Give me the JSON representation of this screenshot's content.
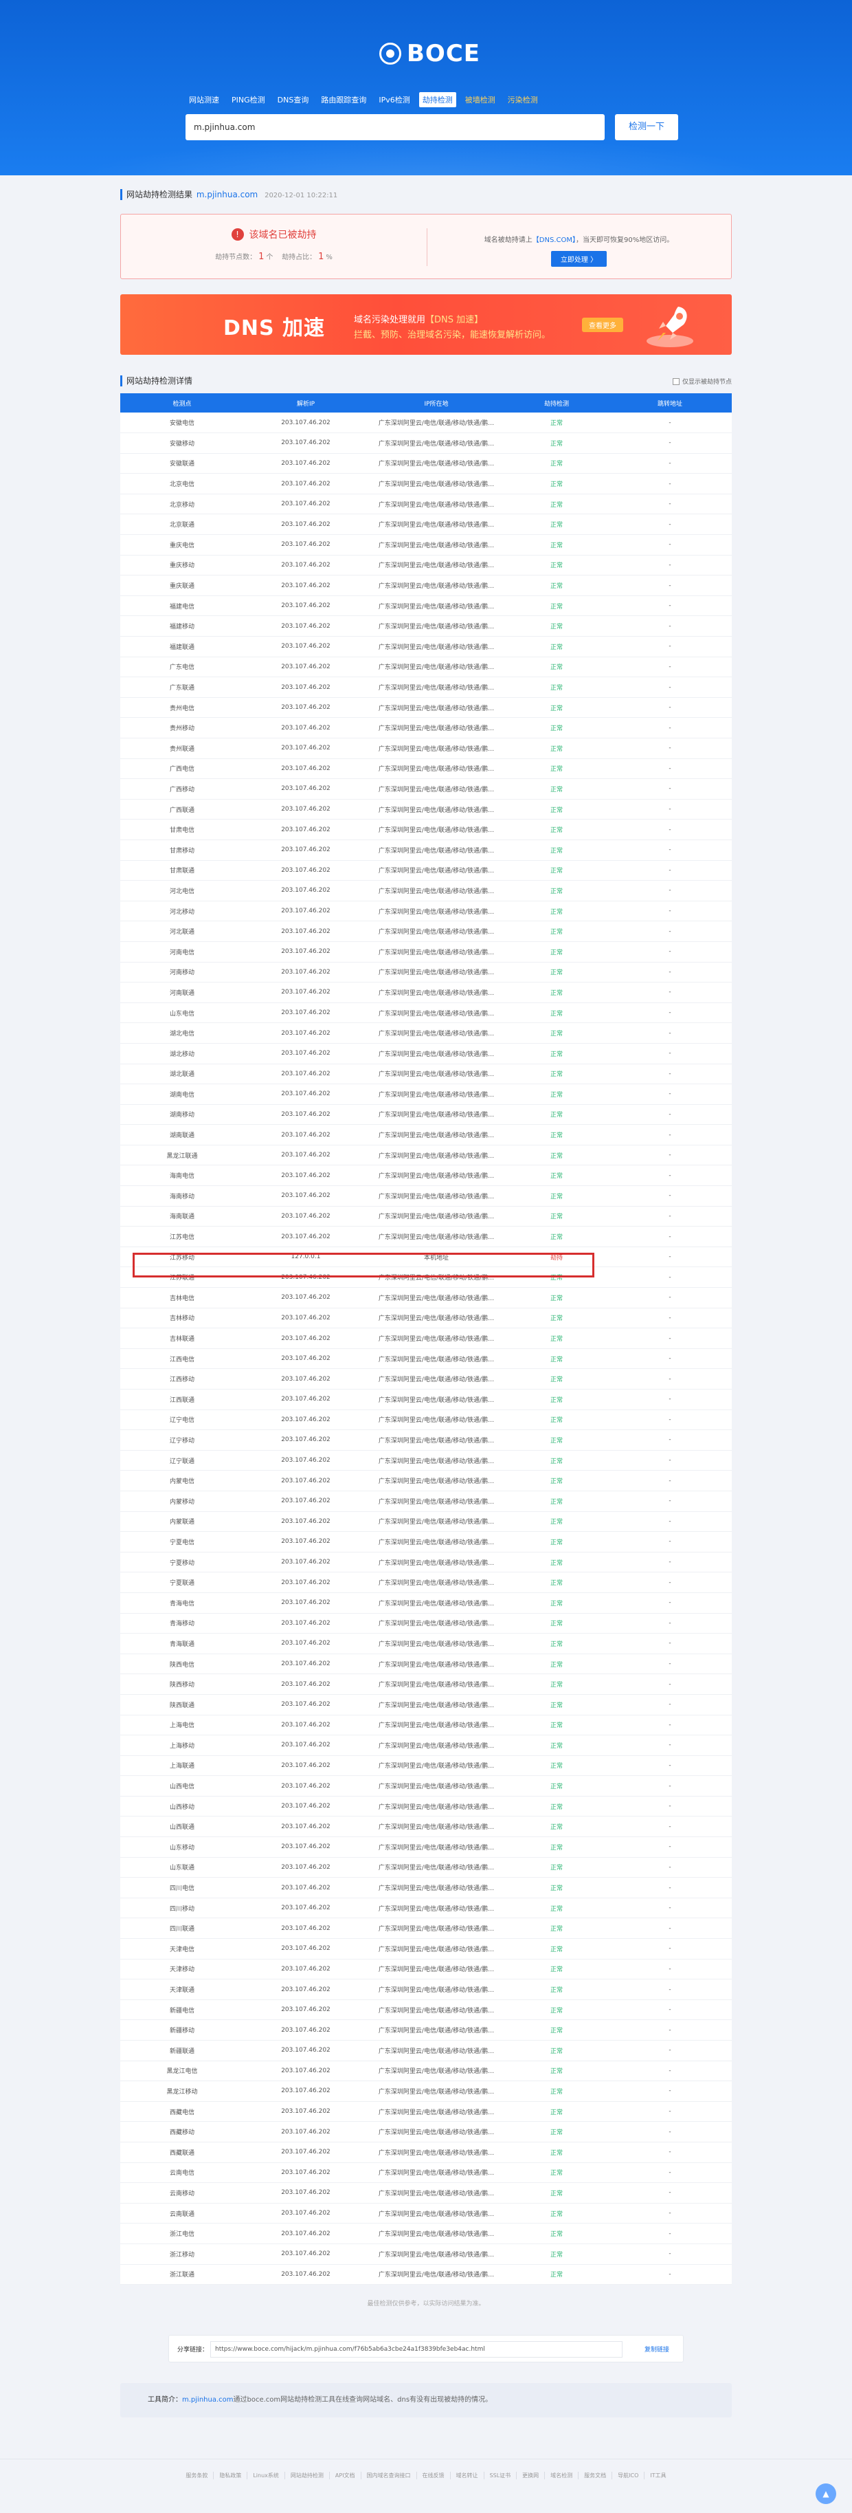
{
  "brand": {
    "logo_text": "BOCE",
    "primary": "#1a73e8",
    "danger": "#e0413d",
    "ok": "#2bb673"
  },
  "nav": [
    {
      "label": "网站测速",
      "style": "normal"
    },
    {
      "label": "PING检测",
      "style": "normal"
    },
    {
      "label": "DNS查询",
      "style": "normal"
    },
    {
      "label": "路由跟踪查询",
      "style": "normal"
    },
    {
      "label": "IPv6检测",
      "style": "normal"
    },
    {
      "label": "劫持检测",
      "style": "active"
    },
    {
      "label": "被墙检测",
      "style": "yellow"
    },
    {
      "label": "污染检测",
      "style": "yellow"
    }
  ],
  "search": {
    "value": "m.pjinhua.com",
    "button": "检测一下"
  },
  "result": {
    "title": "网站劫持检测结果",
    "domain": "m.pjinhua.com",
    "time": "2020-12-01 10:22:11"
  },
  "summary": {
    "warn_icon": "exclamation-icon",
    "warn": "该域名已被劫持",
    "nodes_label": "劫持节点数：",
    "nodes_value": "1",
    "nodes_unit": "个",
    "rate_label": "劫持占比：",
    "rate_value": "1",
    "rate_unit": "%",
    "right_a": "域名被劫持请上",
    "right_link": "【DNS.COM】",
    "right_b": "，当天即可恢复90%地区访问。",
    "button": "立即处理 〉"
  },
  "banner": {
    "big": "DNS 加速",
    "line1_a": "域名污染处理就用",
    "line1_b": "【DNS 加速】",
    "line2": "拦截、预防、治理域名污染，能速恢复解析访问。",
    "button": "查看更多",
    "icon": "rocket-icon"
  },
  "detail": {
    "title": "网站劫持检测详情",
    "checkbox": "仅显示被劫持节点"
  },
  "columns": [
    "检测点",
    "解析IP",
    "IP所在地",
    "劫持检测",
    "跳转地址"
  ],
  "rows": [
    [
      "安徽电信",
      "203.107.46.202",
      "广东深圳阿里云/电信/联通/移动/铁通/鹏…",
      "正常",
      "-"
    ],
    [
      "安徽移动",
      "203.107.46.202",
      "广东深圳阿里云/电信/联通/移动/铁通/鹏…",
      "正常",
      "-"
    ],
    [
      "安徽联通",
      "203.107.46.202",
      "广东深圳阿里云/电信/联通/移动/铁通/鹏…",
      "正常",
      "-"
    ],
    [
      "北京电信",
      "203.107.46.202",
      "广东深圳阿里云/电信/联通/移动/铁通/鹏…",
      "正常",
      "-"
    ],
    [
      "北京移动",
      "203.107.46.202",
      "广东深圳阿里云/电信/联通/移动/铁通/鹏…",
      "正常",
      "-"
    ],
    [
      "北京联通",
      "203.107.46.202",
      "广东深圳阿里云/电信/联通/移动/铁通/鹏…",
      "正常",
      "-"
    ],
    [
      "重庆电信",
      "203.107.46.202",
      "广东深圳阿里云/电信/联通/移动/铁通/鹏…",
      "正常",
      "-"
    ],
    [
      "重庆移动",
      "203.107.46.202",
      "广东深圳阿里云/电信/联通/移动/铁通/鹏…",
      "正常",
      "-"
    ],
    [
      "重庆联通",
      "203.107.46.202",
      "广东深圳阿里云/电信/联通/移动/铁通/鹏…",
      "正常",
      "-"
    ],
    [
      "福建电信",
      "203.107.46.202",
      "广东深圳阿里云/电信/联通/移动/铁通/鹏…",
      "正常",
      "-"
    ],
    [
      "福建移动",
      "203.107.46.202",
      "广东深圳阿里云/电信/联通/移动/铁通/鹏…",
      "正常",
      "-"
    ],
    [
      "福建联通",
      "203.107.46.202",
      "广东深圳阿里云/电信/联通/移动/铁通/鹏…",
      "正常",
      "-"
    ],
    [
      "广东电信",
      "203.107.46.202",
      "广东深圳阿里云/电信/联通/移动/铁通/鹏…",
      "正常",
      "-"
    ],
    [
      "广东联通",
      "203.107.46.202",
      "广东深圳阿里云/电信/联通/移动/铁通/鹏…",
      "正常",
      "-"
    ],
    [
      "贵州电信",
      "203.107.46.202",
      "广东深圳阿里云/电信/联通/移动/铁通/鹏…",
      "正常",
      "-"
    ],
    [
      "贵州移动",
      "203.107.46.202",
      "广东深圳阿里云/电信/联通/移动/铁通/鹏…",
      "正常",
      "-"
    ],
    [
      "贵州联通",
      "203.107.46.202",
      "广东深圳阿里云/电信/联通/移动/铁通/鹏…",
      "正常",
      "-"
    ],
    [
      "广西电信",
      "203.107.46.202",
      "广东深圳阿里云/电信/联通/移动/铁通/鹏…",
      "正常",
      "-"
    ],
    [
      "广西移动",
      "203.107.46.202",
      "广东深圳阿里云/电信/联通/移动/铁通/鹏…",
      "正常",
      "-"
    ],
    [
      "广西联通",
      "203.107.46.202",
      "广东深圳阿里云/电信/联通/移动/铁通/鹏…",
      "正常",
      "-"
    ],
    [
      "甘肃电信",
      "203.107.46.202",
      "广东深圳阿里云/电信/联通/移动/铁通/鹏…",
      "正常",
      "-"
    ],
    [
      "甘肃移动",
      "203.107.46.202",
      "广东深圳阿里云/电信/联通/移动/铁通/鹏…",
      "正常",
      "-"
    ],
    [
      "甘肃联通",
      "203.107.46.202",
      "广东深圳阿里云/电信/联通/移动/铁通/鹏…",
      "正常",
      "-"
    ],
    [
      "河北电信",
      "203.107.46.202",
      "广东深圳阿里云/电信/联通/移动/铁通/鹏…",
      "正常",
      "-"
    ],
    [
      "河北移动",
      "203.107.46.202",
      "广东深圳阿里云/电信/联通/移动/铁通/鹏…",
      "正常",
      "-"
    ],
    [
      "河北联通",
      "203.107.46.202",
      "广东深圳阿里云/电信/联通/移动/铁通/鹏…",
      "正常",
      "-"
    ],
    [
      "河南电信",
      "203.107.46.202",
      "广东深圳阿里云/电信/联通/移动/铁通/鹏…",
      "正常",
      "-"
    ],
    [
      "河南移动",
      "203.107.46.202",
      "广东深圳阿里云/电信/联通/移动/铁通/鹏…",
      "正常",
      "-"
    ],
    [
      "河南联通",
      "203.107.46.202",
      "广东深圳阿里云/电信/联通/移动/铁通/鹏…",
      "正常",
      "-"
    ],
    [
      "山东电信",
      "203.107.46.202",
      "广东深圳阿里云/电信/联通/移动/铁通/鹏…",
      "正常",
      "-"
    ],
    [
      "湖北电信",
      "203.107.46.202",
      "广东深圳阿里云/电信/联通/移动/铁通/鹏…",
      "正常",
      "-"
    ],
    [
      "湖北移动",
      "203.107.46.202",
      "广东深圳阿里云/电信/联通/移动/铁通/鹏…",
      "正常",
      "-"
    ],
    [
      "湖北联通",
      "203.107.46.202",
      "广东深圳阿里云/电信/联通/移动/铁通/鹏…",
      "正常",
      "-"
    ],
    [
      "湖南电信",
      "203.107.46.202",
      "广东深圳阿里云/电信/联通/移动/铁通/鹏…",
      "正常",
      "-"
    ],
    [
      "湖南移动",
      "203.107.46.202",
      "广东深圳阿里云/电信/联通/移动/铁通/鹏…",
      "正常",
      "-"
    ],
    [
      "湖南联通",
      "203.107.46.202",
      "广东深圳阿里云/电信/联通/移动/铁通/鹏…",
      "正常",
      "-"
    ],
    [
      "黑龙江联通",
      "203.107.46.202",
      "广东深圳阿里云/电信/联通/移动/铁通/鹏…",
      "正常",
      "-"
    ],
    [
      "海南电信",
      "203.107.46.202",
      "广东深圳阿里云/电信/联通/移动/铁通/鹏…",
      "正常",
      "-"
    ],
    [
      "海南移动",
      "203.107.46.202",
      "广东深圳阿里云/电信/联通/移动/铁通/鹏…",
      "正常",
      "-"
    ],
    [
      "海南联通",
      "203.107.46.202",
      "广东深圳阿里云/电信/联通/移动/铁通/鹏…",
      "正常",
      "-"
    ],
    [
      "江苏电信",
      "203.107.46.202",
      "广东深圳阿里云/电信/联通/移动/铁通/鹏…",
      "正常",
      "-"
    ],
    [
      "江苏移动",
      "127.0.0.1",
      "本机地址",
      "劫持",
      "-"
    ],
    [
      "江苏联通",
      "203.107.46.202",
      "广东深圳阿里云/电信/联通/移动/铁通/鹏…",
      "正常",
      "-"
    ],
    [
      "吉林电信",
      "203.107.46.202",
      "广东深圳阿里云/电信/联通/移动/铁通/鹏…",
      "正常",
      "-"
    ],
    [
      "吉林移动",
      "203.107.46.202",
      "广东深圳阿里云/电信/联通/移动/铁通/鹏…",
      "正常",
      "-"
    ],
    [
      "吉林联通",
      "203.107.46.202",
      "广东深圳阿里云/电信/联通/移动/铁通/鹏…",
      "正常",
      "-"
    ],
    [
      "江西电信",
      "203.107.46.202",
      "广东深圳阿里云/电信/联通/移动/铁通/鹏…",
      "正常",
      "-"
    ],
    [
      "江西移动",
      "203.107.46.202",
      "广东深圳阿里云/电信/联通/移动/铁通/鹏…",
      "正常",
      "-"
    ],
    [
      "江西联通",
      "203.107.46.202",
      "广东深圳阿里云/电信/联通/移动/铁通/鹏…",
      "正常",
      "-"
    ],
    [
      "辽宁电信",
      "203.107.46.202",
      "广东深圳阿里云/电信/联通/移动/铁通/鹏…",
      "正常",
      "-"
    ],
    [
      "辽宁移动",
      "203.107.46.202",
      "广东深圳阿里云/电信/联通/移动/铁通/鹏…",
      "正常",
      "-"
    ],
    [
      "辽宁联通",
      "203.107.46.202",
      "广东深圳阿里云/电信/联通/移动/铁通/鹏…",
      "正常",
      "-"
    ],
    [
      "内蒙电信",
      "203.107.46.202",
      "广东深圳阿里云/电信/联通/移动/铁通/鹏…",
      "正常",
      "-"
    ],
    [
      "内蒙移动",
      "203.107.46.202",
      "广东深圳阿里云/电信/联通/移动/铁通/鹏…",
      "正常",
      "-"
    ],
    [
      "内蒙联通",
      "203.107.46.202",
      "广东深圳阿里云/电信/联通/移动/铁通/鹏…",
      "正常",
      "-"
    ],
    [
      "宁夏电信",
      "203.107.46.202",
      "广东深圳阿里云/电信/联通/移动/铁通/鹏…",
      "正常",
      "-"
    ],
    [
      "宁夏移动",
      "203.107.46.202",
      "广东深圳阿里云/电信/联通/移动/铁通/鹏…",
      "正常",
      "-"
    ],
    [
      "宁夏联通",
      "203.107.46.202",
      "广东深圳阿里云/电信/联通/移动/铁通/鹏…",
      "正常",
      "-"
    ],
    [
      "青海电信",
      "203.107.46.202",
      "广东深圳阿里云/电信/联通/移动/铁通/鹏…",
      "正常",
      "-"
    ],
    [
      "青海移动",
      "203.107.46.202",
      "广东深圳阿里云/电信/联通/移动/铁通/鹏…",
      "正常",
      "-"
    ],
    [
      "青海联通",
      "203.107.46.202",
      "广东深圳阿里云/电信/联通/移动/铁通/鹏…",
      "正常",
      "-"
    ],
    [
      "陕西电信",
      "203.107.46.202",
      "广东深圳阿里云/电信/联通/移动/铁通/鹏…",
      "正常",
      "-"
    ],
    [
      "陕西移动",
      "203.107.46.202",
      "广东深圳阿里云/电信/联通/移动/铁通/鹏…",
      "正常",
      "-"
    ],
    [
      "陕西联通",
      "203.107.46.202",
      "广东深圳阿里云/电信/联通/移动/铁通/鹏…",
      "正常",
      "-"
    ],
    [
      "上海电信",
      "203.107.46.202",
      "广东深圳阿里云/电信/联通/移动/铁通/鹏…",
      "正常",
      "-"
    ],
    [
      "上海移动",
      "203.107.46.202",
      "广东深圳阿里云/电信/联通/移动/铁通/鹏…",
      "正常",
      "-"
    ],
    [
      "上海联通",
      "203.107.46.202",
      "广东深圳阿里云/电信/联通/移动/铁通/鹏…",
      "正常",
      "-"
    ],
    [
      "山西电信",
      "203.107.46.202",
      "广东深圳阿里云/电信/联通/移动/铁通/鹏…",
      "正常",
      "-"
    ],
    [
      "山西移动",
      "203.107.46.202",
      "广东深圳阿里云/电信/联通/移动/铁通/鹏…",
      "正常",
      "-"
    ],
    [
      "山西联通",
      "203.107.46.202",
      "广东深圳阿里云/电信/联通/移动/铁通/鹏…",
      "正常",
      "-"
    ],
    [
      "山东移动",
      "203.107.46.202",
      "广东深圳阿里云/电信/联通/移动/铁通/鹏…",
      "正常",
      "-"
    ],
    [
      "山东联通",
      "203.107.46.202",
      "广东深圳阿里云/电信/联通/移动/铁通/鹏…",
      "正常",
      "-"
    ],
    [
      "四川电信",
      "203.107.46.202",
      "广东深圳阿里云/电信/联通/移动/铁通/鹏…",
      "正常",
      "-"
    ],
    [
      "四川移动",
      "203.107.46.202",
      "广东深圳阿里云/电信/联通/移动/铁通/鹏…",
      "正常",
      "-"
    ],
    [
      "四川联通",
      "203.107.46.202",
      "广东深圳阿里云/电信/联通/移动/铁通/鹏…",
      "正常",
      "-"
    ],
    [
      "天津电信",
      "203.107.46.202",
      "广东深圳阿里云/电信/联通/移动/铁通/鹏…",
      "正常",
      "-"
    ],
    [
      "天津移动",
      "203.107.46.202",
      "广东深圳阿里云/电信/联通/移动/铁通/鹏…",
      "正常",
      "-"
    ],
    [
      "天津联通",
      "203.107.46.202",
      "广东深圳阿里云/电信/联通/移动/铁通/鹏…",
      "正常",
      "-"
    ],
    [
      "新疆电信",
      "203.107.46.202",
      "广东深圳阿里云/电信/联通/移动/铁通/鹏…",
      "正常",
      "-"
    ],
    [
      "新疆移动",
      "203.107.46.202",
      "广东深圳阿里云/电信/联通/移动/铁通/鹏…",
      "正常",
      "-"
    ],
    [
      "新疆联通",
      "203.107.46.202",
      "广东深圳阿里云/电信/联通/移动/铁通/鹏…",
      "正常",
      "-"
    ],
    [
      "黑龙江电信",
      "203.107.46.202",
      "广东深圳阿里云/电信/联通/移动/铁通/鹏…",
      "正常",
      "-"
    ],
    [
      "黑龙江移动",
      "203.107.46.202",
      "广东深圳阿里云/电信/联通/移动/铁通/鹏…",
      "正常",
      "-"
    ],
    [
      "西藏电信",
      "203.107.46.202",
      "广东深圳阿里云/电信/联通/移动/铁通/鹏…",
      "正常",
      "-"
    ],
    [
      "西藏移动",
      "203.107.46.202",
      "广东深圳阿里云/电信/联通/移动/铁通/鹏…",
      "正常",
      "-"
    ],
    [
      "西藏联通",
      "203.107.46.202",
      "广东深圳阿里云/电信/联通/移动/铁通/鹏…",
      "正常",
      "-"
    ],
    [
      "云南电信",
      "203.107.46.202",
      "广东深圳阿里云/电信/联通/移动/铁通/鹏…",
      "正常",
      "-"
    ],
    [
      "云南移动",
      "203.107.46.202",
      "广东深圳阿里云/电信/联通/移动/铁通/鹏…",
      "正常",
      "-"
    ],
    [
      "云南联通",
      "203.107.46.202",
      "广东深圳阿里云/电信/联通/移动/铁通/鹏…",
      "正常",
      "-"
    ],
    [
      "浙江电信",
      "203.107.46.202",
      "广东深圳阿里云/电信/联通/移动/铁通/鹏…",
      "正常",
      "-"
    ],
    [
      "浙江移动",
      "203.107.46.202",
      "广东深圳阿里云/电信/联通/移动/铁通/鹏…",
      "正常",
      "-"
    ],
    [
      "浙江联通",
      "203.107.46.202",
      "广东深圳阿里云/电信/联通/移动/铁通/鹏…",
      "正常",
      "-"
    ]
  ],
  "note": "最佳检测仅供参考，以实际访问结果为准。",
  "share": {
    "label": "分享链接：",
    "url": "https://www.boce.com/hijack/m.pjinhua.com/f76b5ab6a3cbe24a1f3839bfe3eb4ac.html",
    "copy": "复制链接"
  },
  "intro": {
    "label": "工具简介：",
    "domain": "m.pjinhua.com",
    "text": "通过boce.com网站劫持检测工具在线查询网站域名、dns有没有出现被劫持的情况。"
  },
  "footer": [
    "服务条款",
    "隐私政策",
    "Linux系统",
    "网站劫持检测",
    "API文档",
    "国内域名查询接口",
    "在线反馈",
    "域名转让",
    "SSL证书",
    "更换网",
    "域名检测",
    "服务文档",
    "导航ICO",
    "IT工具"
  ],
  "backtop_icon": "arrow-up-icon"
}
